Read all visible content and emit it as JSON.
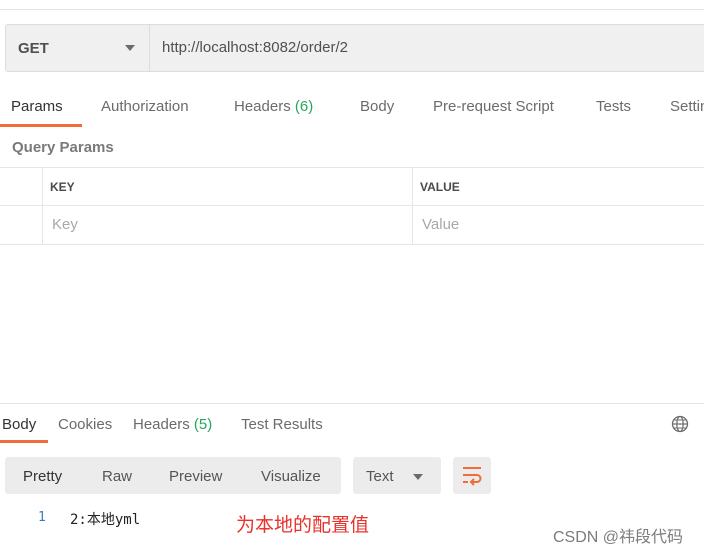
{
  "request": {
    "method": "GET",
    "url": "http://localhost:8082/order/2"
  },
  "request_tabs": [
    {
      "label": "Params"
    },
    {
      "label": "Authorization"
    },
    {
      "label": "Headers",
      "count": "(6)"
    },
    {
      "label": "Body"
    },
    {
      "label": "Pre-request Script"
    },
    {
      "label": "Tests"
    },
    {
      "label": "Settings"
    }
  ],
  "query_params": {
    "title": "Query Params",
    "columns": [
      "KEY",
      "VALUE"
    ],
    "placeholders": {
      "key": "Key",
      "value": "Value"
    }
  },
  "response_tabs": [
    {
      "label": "Body"
    },
    {
      "label": "Cookies"
    },
    {
      "label": "Headers",
      "count": "(5)"
    },
    {
      "label": "Test Results"
    }
  ],
  "view_modes": [
    "Pretty",
    "Raw",
    "Preview",
    "Visualize"
  ],
  "format": {
    "selected": "Text"
  },
  "response_body": {
    "line_number": "1",
    "content": "2:本地yml"
  },
  "annotation": "为本地的配置值",
  "watermark": "CSDN @祎段代码",
  "colors": {
    "accent": "#f26b3a",
    "count_green": "#26a65b",
    "annotation_red": "#e8322b"
  },
  "icons": [
    "chevron-down-icon",
    "globe-icon",
    "wrap-lines-icon"
  ]
}
